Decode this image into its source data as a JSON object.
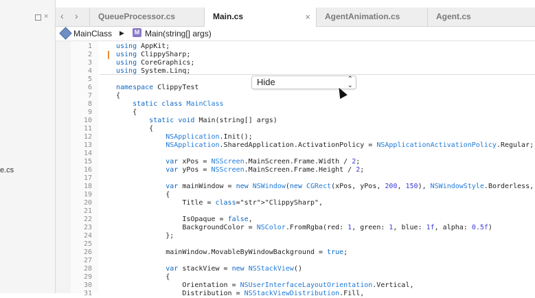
{
  "left_pane": {
    "fragment": "e.cs"
  },
  "tabs": [
    {
      "label": "QueueProcessor.cs",
      "active": false
    },
    {
      "label": "Main.cs",
      "active": true,
      "close": "×"
    },
    {
      "label": "AgentAnimation.cs",
      "active": false
    },
    {
      "label": "Agent.cs",
      "active": false
    }
  ],
  "nav": {
    "back": "‹",
    "forward": "›"
  },
  "breadcrumb": {
    "class_name": "MainClass",
    "separator": "▶",
    "method_icon": "M",
    "method_name": "Main(string[] args)"
  },
  "popup": {
    "value": "Hide",
    "chevrons": "⌃⌄"
  },
  "line_numbers": [
    "1",
    "2",
    "3",
    "4",
    "5",
    "6",
    "7",
    "8",
    "9",
    "10",
    "11",
    "12",
    "13",
    "14",
    "15",
    "16",
    "17",
    "18",
    "19",
    "20",
    "21",
    "22",
    "23",
    "24",
    "25",
    "26",
    "27",
    "28",
    "29",
    "30",
    "31"
  ],
  "code_lines": [
    "using AppKit;",
    "using ClippySharp;",
    "using CoreGraphics;",
    "using System.Linq;",
    "",
    "namespace ClippyTest",
    "{",
    "    static class MainClass",
    "    {",
    "        static void Main(string[] args)",
    "        {",
    "            NSApplication.Init();",
    "            NSApplication.SharedApplication.ActivationPolicy = NSApplicationActivationPolicy.Regular;",
    "",
    "            var xPos = NSScreen.MainScreen.Frame.Width / 2;",
    "            var yPos = NSScreen.MainScreen.Frame.Height / 2;",
    "",
    "            var mainWindow = new NSWindow(new CGRect(xPos, yPos, 200, 150), NSWindowStyle.Borderless, N",
    "            {",
    "                Title = \"ClippySharp\",",
    "",
    "                IsOpaque = false,",
    "                BackgroundColor = NSColor.FromRgba(red: 1, green: 1, blue: 1f, alpha: 0.5f)",
    "            };",
    "",
    "            mainWindow.MovableByWindowBackground = true;",
    "",
    "            var stackView = new NSStackView()",
    "            {",
    "                Orientation = NSUserInterfaceLayoutOrientation.Vertical,",
    "                Distribution = NSStackViewDistribution.Fill,"
  ]
}
